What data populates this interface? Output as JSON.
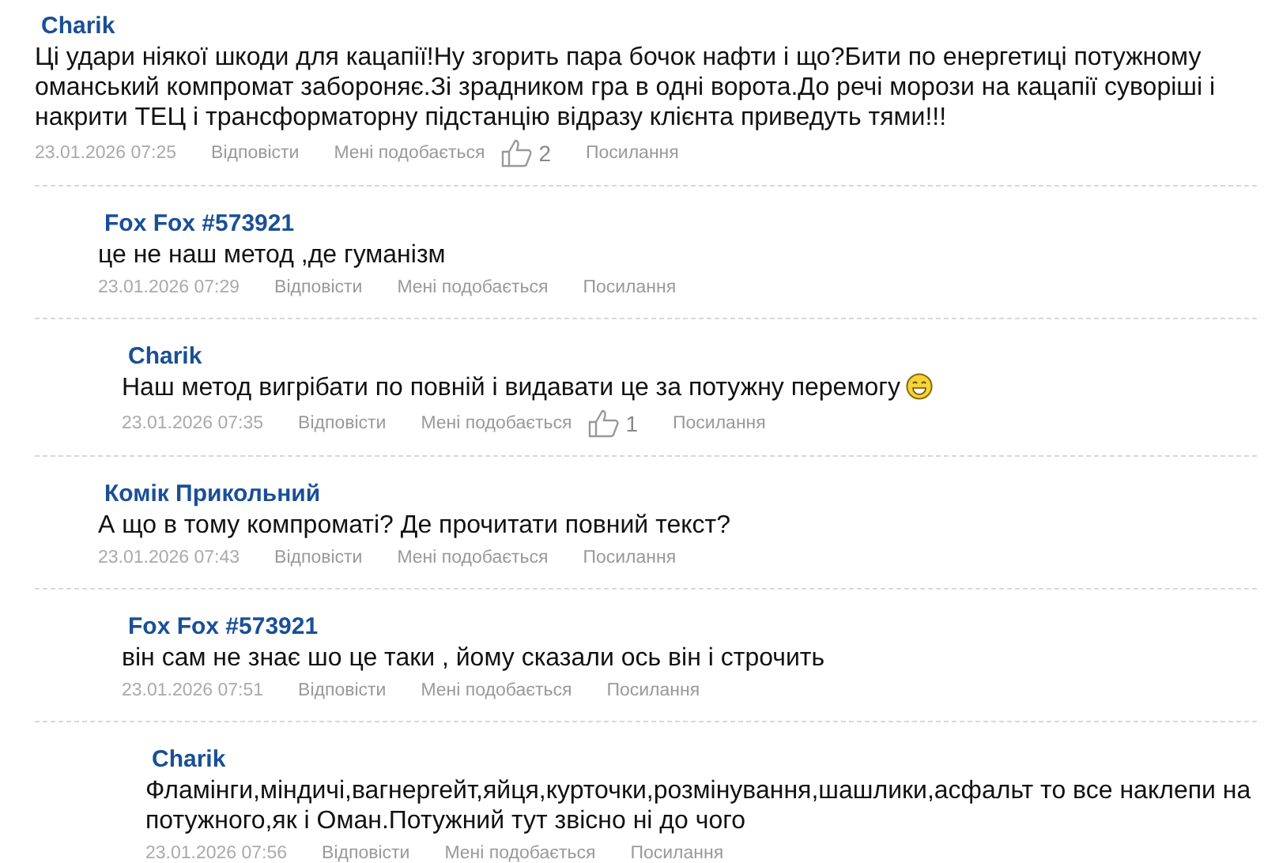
{
  "comments": [
    {
      "author": "Charik",
      "text": "Ці удари ніякої шкоди для кацапії!Ну згорить пара бочок нафти і що?Бити по енергетиці потужному оманський компромат забороняє.Зі зрадником гра в одні ворота.До речі морози на кацапії суворіші і накрити ТЕЦ і трансформаторну підстанцію відразу клієнта приведуть тями!!!",
      "smiley": false,
      "date": "23.01.2026 07:25",
      "reply": "Відповісти",
      "like": "Мені подобається",
      "likes": "2",
      "link": "Посилання",
      "children": [
        {
          "author": "Fox Fox #573921",
          "text": "це не наш метод ,де гуманізм",
          "smiley": false,
          "date": "23.01.2026 07:29",
          "reply": "Відповісти",
          "like": "Мені подобається",
          "link": "Посилання",
          "children": [
            {
              "author": "Charik",
              "text": "Наш метод вигрібати по повній і видавати це за потужну перемогу",
              "smiley": true,
              "date": "23.01.2026 07:35",
              "reply": "Відповісти",
              "like": "Мені подобається",
              "likes": "1",
              "link": "Посилання"
            }
          ]
        },
        {
          "author": "Комік Прикольний",
          "text": "А що в тому компроматі? Де прочитати повний текст?",
          "smiley": false,
          "date": "23.01.2026 07:43",
          "reply": "Відповісти",
          "like": "Мені подобається",
          "link": "Посилання",
          "children": [
            {
              "author": "Fox Fox #573921",
              "text": "він сам не знає шо це таки , йому сказали ось він і строчить",
              "smiley": false,
              "date": "23.01.2026 07:51",
              "reply": "Відповісти",
              "like": "Мені подобається",
              "link": "Посилання",
              "children": [
                {
                  "author": "Charik",
                  "text": "Фламінги,міндичі,вагнергейт,яйця,курточки,розмінування,шашлики,асфальт то все наклепи на потужного,як і Оман.Потужний тут звісно ні до чого",
                  "smiley": false,
                  "date": "23.01.2026 07:56",
                  "reply": "Відповісти",
                  "like": "Мені подобається",
                  "link": "Посилання"
                }
              ]
            }
          ]
        }
      ]
    }
  ]
}
